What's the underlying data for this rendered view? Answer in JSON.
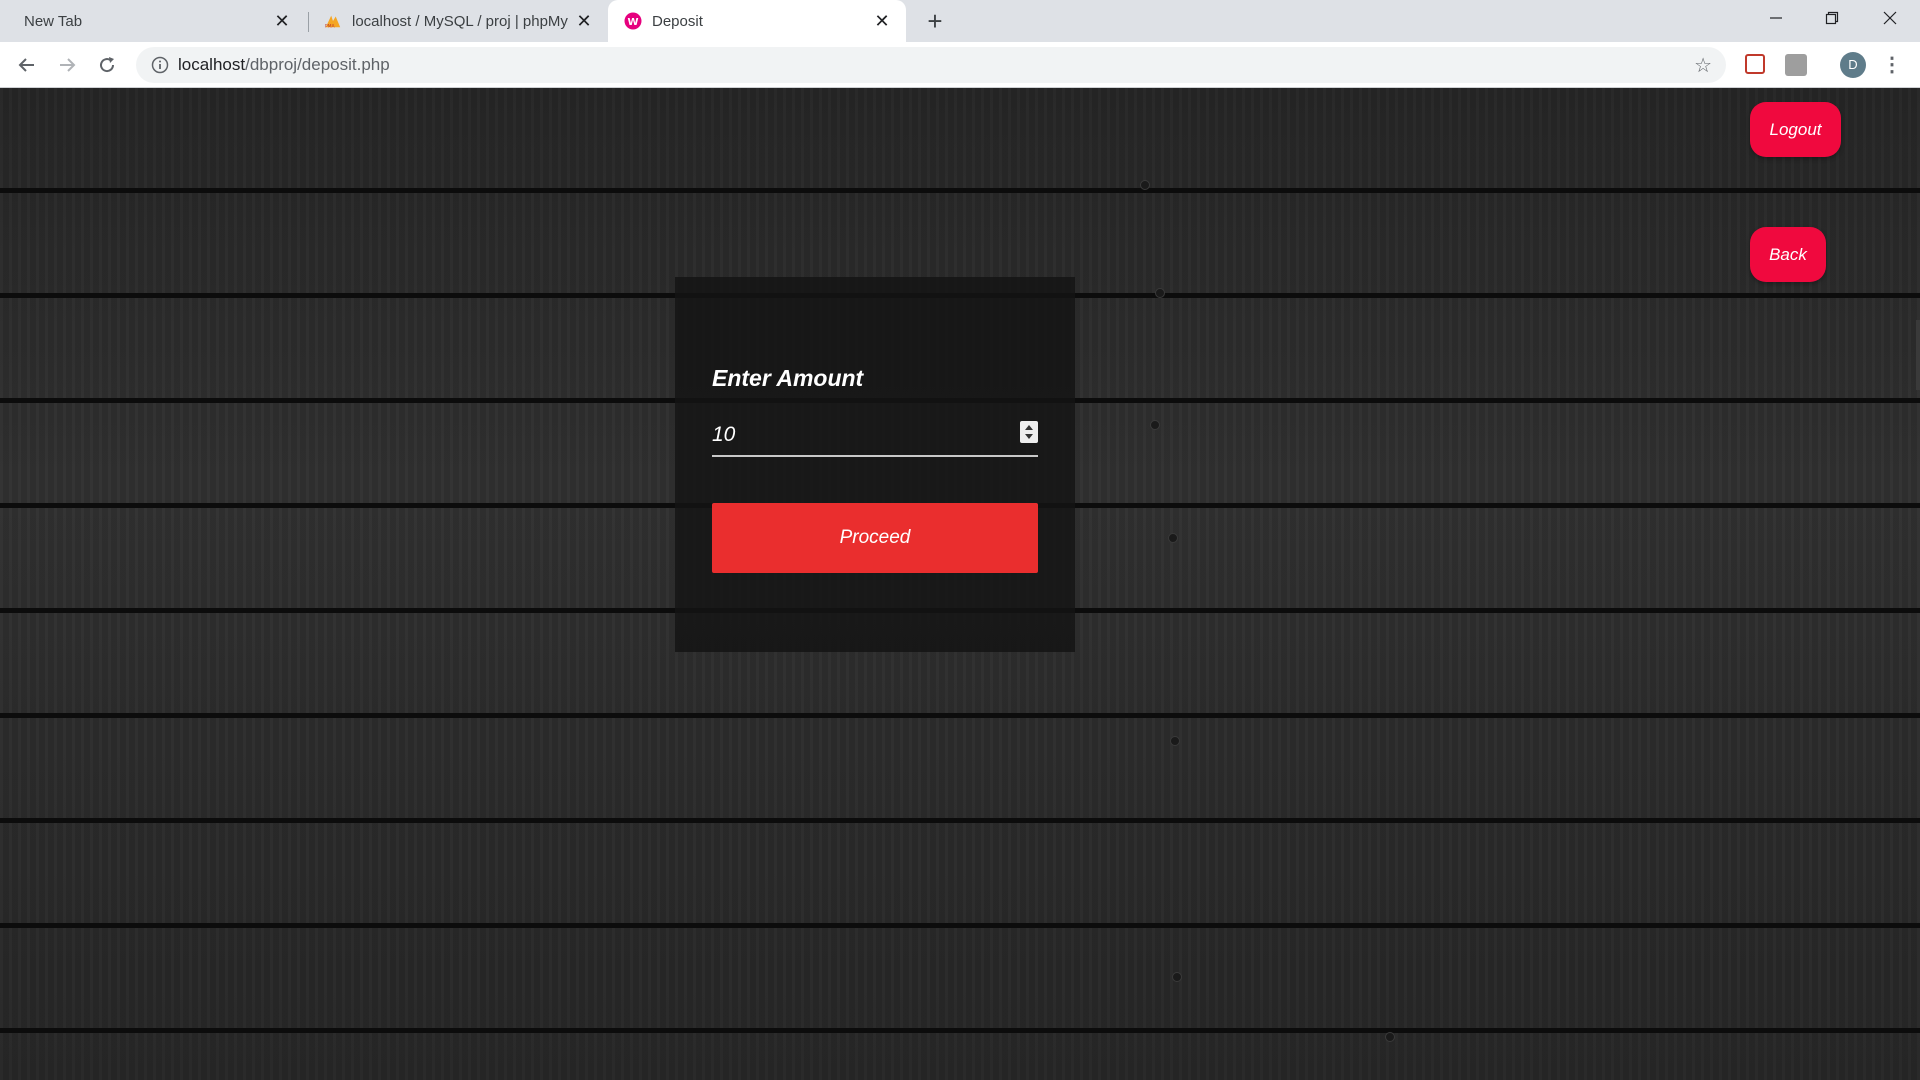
{
  "browser": {
    "tabs": [
      {
        "title": "New Tab",
        "active": false
      },
      {
        "title": "localhost / MySQL / proj | phpMy",
        "active": false
      },
      {
        "title": "Deposit",
        "active": true
      }
    ],
    "address": {
      "host": "localhost",
      "path": "/dbproj/deposit.php"
    },
    "profile_initial": "D"
  },
  "header": {
    "logout_label": "Logout",
    "back_label": "Back"
  },
  "form": {
    "amount_label": "Enter Amount",
    "amount_value": "10",
    "proceed_label": "Proceed"
  },
  "colors": {
    "accent_button": "#f0093e",
    "proceed_button": "#ea2e2e"
  }
}
